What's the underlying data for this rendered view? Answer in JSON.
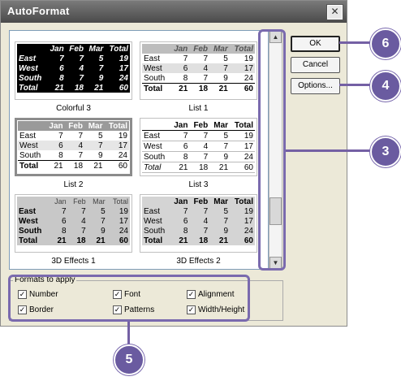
{
  "dialog": {
    "title": "AutoFormat",
    "close_glyph": "✕"
  },
  "formats": [
    {
      "name": "Colorful 3",
      "style": "s-colorful",
      "header": [
        "",
        "Jan",
        "Feb",
        "Mar",
        "Total"
      ],
      "rows": [
        [
          "East",
          "7",
          "7",
          "5",
          "19"
        ],
        [
          "West",
          "6",
          "4",
          "7",
          "17"
        ],
        [
          "South",
          "8",
          "7",
          "9",
          "24"
        ],
        [
          "Total",
          "21",
          "18",
          "21",
          "60"
        ]
      ]
    },
    {
      "name": "List 1",
      "style": "s-list1",
      "header": [
        "",
        "Jan",
        "Feb",
        "Mar",
        "Total"
      ],
      "rows": [
        [
          "East",
          "7",
          "7",
          "5",
          "19"
        ],
        [
          "West",
          "6",
          "4",
          "7",
          "17"
        ],
        [
          "South",
          "8",
          "7",
          "9",
          "24"
        ],
        [
          "Total",
          "21",
          "18",
          "21",
          "60"
        ]
      ]
    },
    {
      "name": "List 2",
      "style": "s-list2",
      "header": [
        "",
        "Jan",
        "Feb",
        "Mar",
        "Total"
      ],
      "rows": [
        [
          "East",
          "7",
          "7",
          "5",
          "19"
        ],
        [
          "West",
          "6",
          "4",
          "7",
          "17"
        ],
        [
          "South",
          "8",
          "7",
          "9",
          "24"
        ],
        [
          "Total",
          "21",
          "18",
          "21",
          "60"
        ]
      ]
    },
    {
      "name": "List 3",
      "style": "s-list3",
      "header": [
        "",
        "Jan",
        "Feb",
        "Mar",
        "Total"
      ],
      "rows": [
        [
          "East",
          "7",
          "7",
          "5",
          "19"
        ],
        [
          "West",
          "6",
          "4",
          "7",
          "17"
        ],
        [
          "South",
          "8",
          "7",
          "9",
          "24"
        ],
        [
          "Total",
          "21",
          "18",
          "21",
          "60"
        ]
      ]
    },
    {
      "name": "3D Effects 1",
      "style": "s-3d1",
      "header": [
        "",
        "Jan",
        "Feb",
        "Mar",
        "Total"
      ],
      "rows": [
        [
          "East",
          "7",
          "7",
          "5",
          "19"
        ],
        [
          "West",
          "6",
          "4",
          "7",
          "17"
        ],
        [
          "South",
          "8",
          "7",
          "9",
          "24"
        ],
        [
          "Total",
          "21",
          "18",
          "21",
          "60"
        ]
      ]
    },
    {
      "name": "3D Effects 2",
      "style": "s-3d2",
      "header": [
        "",
        "Jan",
        "Feb",
        "Mar",
        "Total"
      ],
      "rows": [
        [
          "East",
          "7",
          "7",
          "5",
          "19"
        ],
        [
          "West",
          "6",
          "4",
          "7",
          "17"
        ],
        [
          "South",
          "8",
          "7",
          "9",
          "24"
        ],
        [
          "Total",
          "21",
          "18",
          "21",
          "60"
        ]
      ]
    }
  ],
  "selected_format": "List 2",
  "buttons": {
    "ok": "OK",
    "cancel": "Cancel",
    "options": "Options..."
  },
  "formats_to_apply": {
    "label": "Formats to apply",
    "options": [
      {
        "label": "Number",
        "checked": true
      },
      {
        "label": "Font",
        "checked": true
      },
      {
        "label": "Alignment",
        "checked": true
      },
      {
        "label": "Border",
        "checked": true
      },
      {
        "label": "Patterns",
        "checked": true
      },
      {
        "label": "Width/Height",
        "checked": true
      }
    ]
  },
  "callouts": {
    "c6": "6",
    "c4": "4",
    "c3": "3",
    "c5": "5"
  },
  "colors": {
    "callout": "#6a5ba0",
    "dialog_bg": "#ece9d8"
  },
  "scrollbar": {
    "up_glyph": "▲",
    "down_glyph": "▼"
  }
}
